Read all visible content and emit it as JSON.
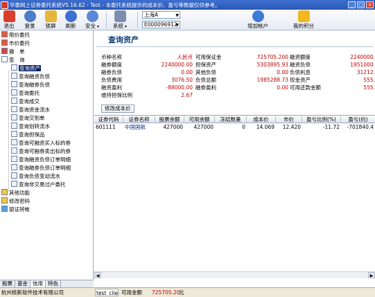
{
  "window": {
    "title": "华泰网上证券委托系统V5.16.62 - Test - 本委托系统提示的成本价、盈亏等数据仅供参考。"
  },
  "toolbar": {
    "buttons": [
      {
        "label": "退出",
        "icon": "exit-icon"
      },
      {
        "label": "登录",
        "icon": "login-icon"
      },
      {
        "label": "锁屏",
        "icon": "lock-screen-icon"
      },
      {
        "label": "刷新",
        "icon": "refresh-icon"
      },
      {
        "label": "安全",
        "icon": "security-icon"
      },
      {
        "label": "系统",
        "icon": "system-tools-icon"
      }
    ],
    "market_combo": "上海A",
    "account_combo": "E000096912",
    "add_account_label": "增加帐户",
    "my_points_label": "我的积分"
  },
  "sidebar": {
    "items": [
      {
        "label": "限价委托"
      },
      {
        "label": "市价委托"
      },
      {
        "label": "撤　单"
      },
      {
        "label": "查　询"
      },
      {
        "label": "查询资产"
      },
      {
        "label": "查询融资负债"
      },
      {
        "label": "查询融券负债"
      },
      {
        "label": "查询委托"
      },
      {
        "label": "查询成交"
      },
      {
        "label": "查询资金流水"
      },
      {
        "label": "查询交割单"
      },
      {
        "label": "查询划转流水"
      },
      {
        "label": "查询担保品"
      },
      {
        "label": "查询可融资买入标的券"
      },
      {
        "label": "查询可融券卖出标的券"
      },
      {
        "label": "查询融资负债订单明细"
      },
      {
        "label": "查询融券负债订单明细"
      },
      {
        "label": "查询负债变动流水"
      },
      {
        "label": "查询非交易过户委托"
      },
      {
        "label": "其他功能"
      },
      {
        "label": "修改密码"
      },
      {
        "label": "银证转帐"
      }
    ],
    "bottom_tabs": [
      "股票",
      "基金",
      "信用",
      "特色"
    ]
  },
  "main": {
    "title": "查询资产",
    "summary": [
      [
        {
          "label": "币种名称",
          "value": "人民币"
        },
        {
          "label": "可用保证金",
          "value": "725705.200"
        },
        {
          "label": "融资额度",
          "value": "2240000."
        }
      ],
      [
        {
          "label": "融券额度",
          "value": "2240000.00"
        },
        {
          "label": "担保资产",
          "value": "5303895.93"
        },
        {
          "label": "融资负债",
          "value": "1951000."
        }
      ],
      [
        {
          "label": "融券负债",
          "value": "0.00"
        },
        {
          "label": "其他负债",
          "value": "0.00"
        },
        {
          "label": "负债利息",
          "value": "31212."
        }
      ],
      [
        {
          "label": "负债费用",
          "value": "3076.50"
        },
        {
          "label": "负债总额",
          "value": "1985288.73"
        },
        {
          "label": "现金资产",
          "value": "555."
        }
      ],
      [
        {
          "label": "融资盈利",
          "value": "-88000.00"
        },
        {
          "label": "融券盈利",
          "value": "0.00"
        },
        {
          "label": "可用还款金额",
          "value": "555."
        }
      ],
      [
        {
          "label": "维持担保比例",
          "value": "2.67"
        }
      ]
    ],
    "change_cost_button": "修改成本价",
    "table": {
      "headers": [
        "证券代码",
        "证券名称",
        "股票余额",
        "可用余额",
        "冻结数量",
        "成本价",
        "市价",
        "盈亏比例(%)",
        "盈亏(约)"
      ],
      "rows": [
        [
          "601111",
          "中国国航",
          "427000",
          "427000",
          "0",
          "14.069",
          "12.420",
          "-11.72",
          "-701840.4"
        ]
      ]
    }
  },
  "statusbar": {
    "company": "杭州核新软件技术有限公司",
    "user": "test_clie",
    "available_label": "可用金额",
    "available_value": "725705.20",
    "unit": "元"
  },
  "colors": {
    "title_bar": "#2a58b6",
    "selected_item": "#0a246a",
    "value_red": "#c00000",
    "security_name": "#0a2a8a"
  }
}
